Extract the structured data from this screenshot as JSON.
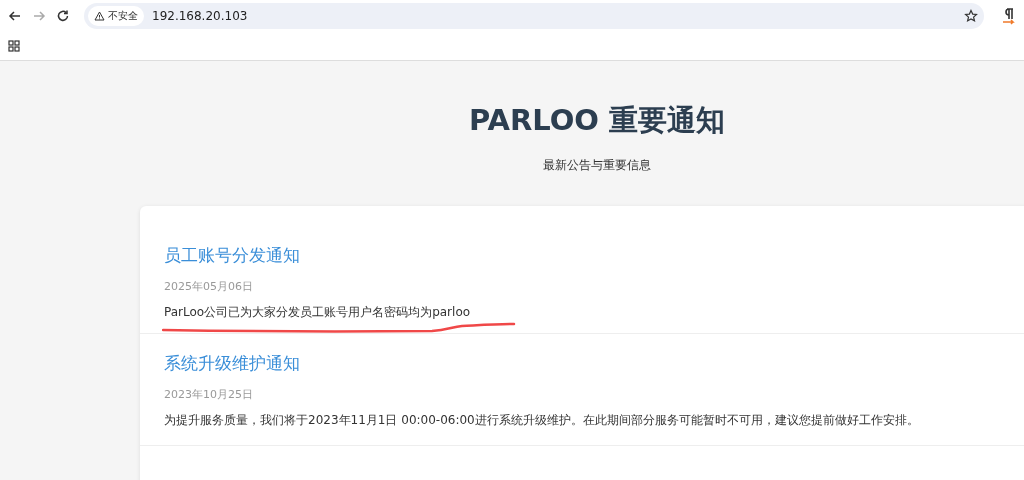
{
  "browser": {
    "security_label": "不安全",
    "url": "192.168.20.103"
  },
  "page": {
    "title": "PARLOO 重要通知",
    "subtitle": "最新公告与重要信息"
  },
  "notices": [
    {
      "title": "员工账号分发通知",
      "date": "2025年05月06日",
      "body": "ParLoo公司已为大家分发员工账号用户名密码均为parloo",
      "underlined": true
    },
    {
      "title": "系统升级维护通知",
      "date": "2023年10月25日",
      "body": "为提升服务质量，我们将于2023年11月1日 00:00-06:00进行系统升级维护。在此期间部分服务可能暂时不可用，建议您提前做好工作安排。",
      "underlined": false
    }
  ]
}
